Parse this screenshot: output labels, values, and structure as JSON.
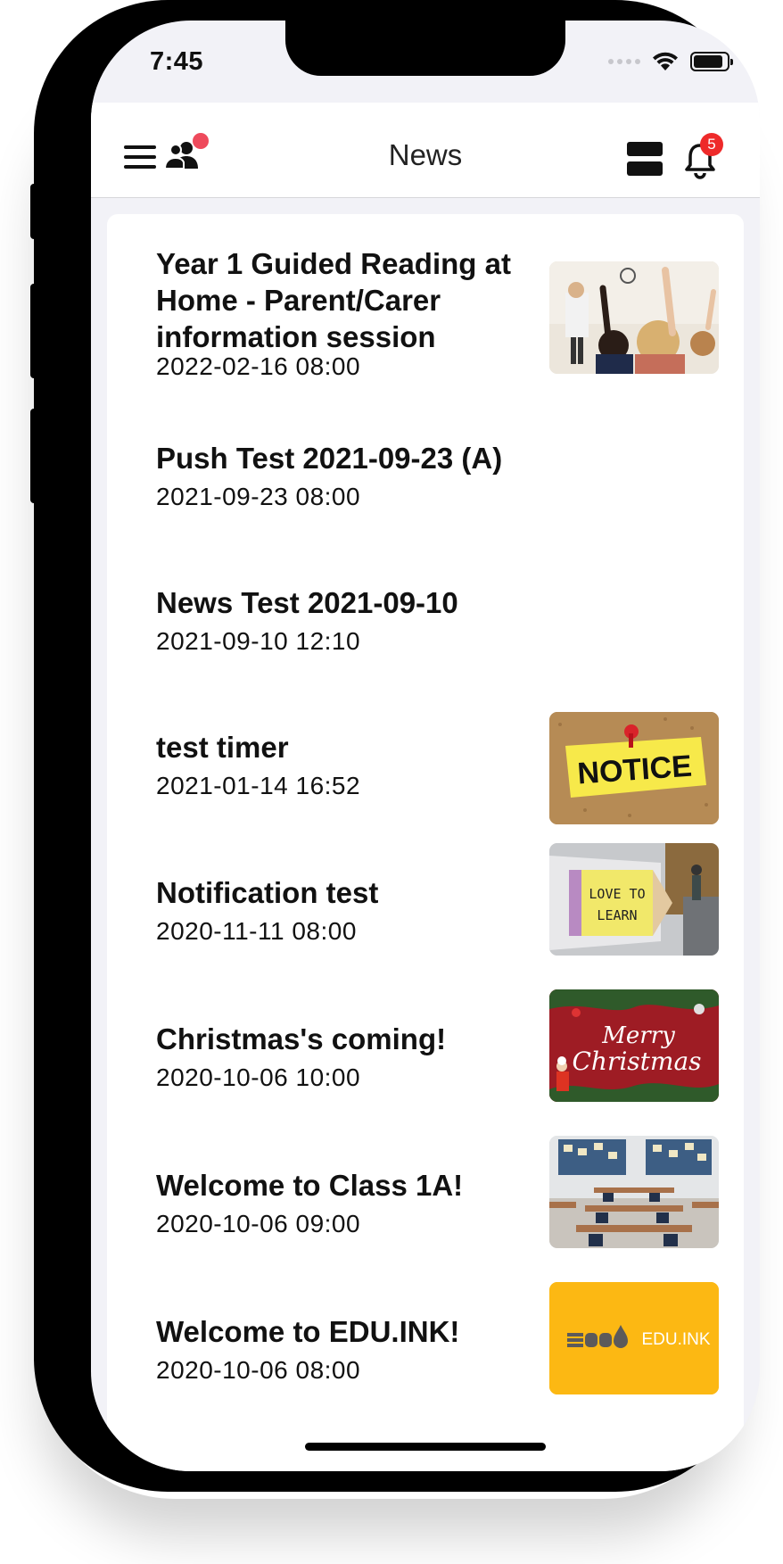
{
  "status_bar": {
    "time": "7:45"
  },
  "header": {
    "title": "News",
    "notification_count": "5"
  },
  "news": [
    {
      "title": "Year 1 Guided Reading at Home - Parent/Carer information session",
      "date": "2022-02-16 08:00",
      "thumbnail": "classroom-hands-raised"
    },
    {
      "title": "Push Test 2021-09-23 (A)",
      "date": "2021-09-23 08:00",
      "thumbnail": ""
    },
    {
      "title": "News Test 2021-09-10",
      "date": "2021-09-10 12:10",
      "thumbnail": ""
    },
    {
      "title": "test timer",
      "date": "2021-01-14 16:52",
      "thumbnail": "notice-board"
    },
    {
      "title": "Notification test",
      "date": "2020-11-11 08:00",
      "thumbnail": "love-to-learn-pencil"
    },
    {
      "title": "Christmas's coming!",
      "date": "2020-10-06 10:00",
      "thumbnail": "merry-christmas"
    },
    {
      "title": "Welcome to Class 1A!",
      "date": "2020-10-06 09:00",
      "thumbnail": "empty-classroom"
    },
    {
      "title": "Welcome to EDU.INK!",
      "date": "2020-10-06 08:00",
      "thumbnail": "edu-ink-logo"
    }
  ],
  "thumb_text": {
    "notice": "NOTICE",
    "love": "LOVE TO",
    "learn": "LEARN",
    "merry": "Merry",
    "christmas": "Christmas",
    "edu_logo": "EDU.INK"
  },
  "colors": {
    "badge": "#ee2a2a",
    "people_dot": "#ee4a5c",
    "edu_yellow": "#fcb813",
    "background": "#f2f2f7"
  }
}
